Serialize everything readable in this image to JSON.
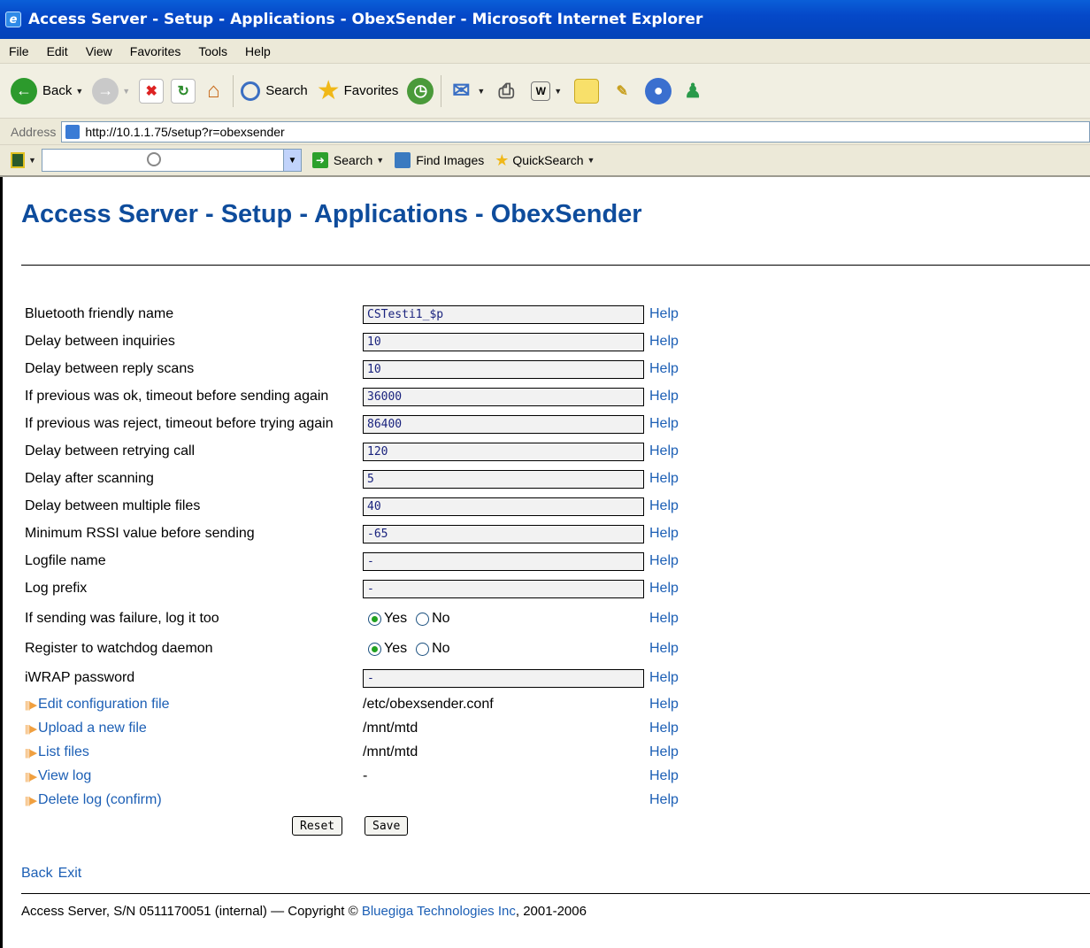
{
  "window": {
    "title": "Access Server - Setup - Applications - ObexSender - Microsoft Internet Explorer"
  },
  "menu": [
    "File",
    "Edit",
    "View",
    "Favorites",
    "Tools",
    "Help"
  ],
  "toolbar": {
    "back_label": "Back",
    "search_label": "Search",
    "favorites_label": "Favorites"
  },
  "address": {
    "label": "Address",
    "url": "http://10.1.1.75/setup?r=obexsender"
  },
  "searchbar": {
    "search_label": "Search",
    "find_images_label": "Find Images",
    "quicksearch_label": "QuickSearch"
  },
  "page": {
    "title": "Access Server - Setup - Applications - ObexSender",
    "help_label": "Help",
    "fields": [
      {
        "label": "Bluetooth friendly name",
        "value": "CSTesti1_$p"
      },
      {
        "label": "Delay between inquiries",
        "value": "10"
      },
      {
        "label": "Delay between reply scans",
        "value": "10"
      },
      {
        "label": "If previous was ok, timeout before sending again",
        "value": "36000"
      },
      {
        "label": "If previous was reject, timeout before trying again",
        "value": "86400"
      },
      {
        "label": "Delay between retrying call",
        "value": "120"
      },
      {
        "label": "Delay after scanning",
        "value": "5"
      },
      {
        "label": "Delay between multiple files",
        "value": "40"
      },
      {
        "label": "Minimum RSSI value before sending",
        "value": "-65"
      },
      {
        "label": "Logfile name",
        "value": "-"
      },
      {
        "label": "Log prefix",
        "value": "-"
      }
    ],
    "radios": [
      {
        "label": "If sending was failure, log it too",
        "yes": "Yes",
        "no": "No",
        "selected": "Yes"
      },
      {
        "label": "Register to watchdog daemon",
        "yes": "Yes",
        "no": "No",
        "selected": "Yes"
      }
    ],
    "password_field": {
      "label": "iWRAP password",
      "value": "-"
    },
    "links": [
      {
        "label": "Edit configuration file",
        "value": "/etc/obexsender.conf"
      },
      {
        "label": "Upload a new file",
        "value": "/mnt/mtd"
      },
      {
        "label": "List files",
        "value": "/mnt/mtd"
      },
      {
        "label": "View log",
        "value": "-"
      },
      {
        "label": "Delete log (confirm)",
        "value": ""
      }
    ],
    "reset_label": "Reset",
    "save_label": "Save",
    "nav_back": "Back",
    "nav_exit": "Exit",
    "footer_prefix": "Access Server, S/N 0511170051 (internal) — Copyright © ",
    "footer_brand": "Bluegiga Technologies Inc",
    "footer_suffix": ", 2001-2006"
  }
}
